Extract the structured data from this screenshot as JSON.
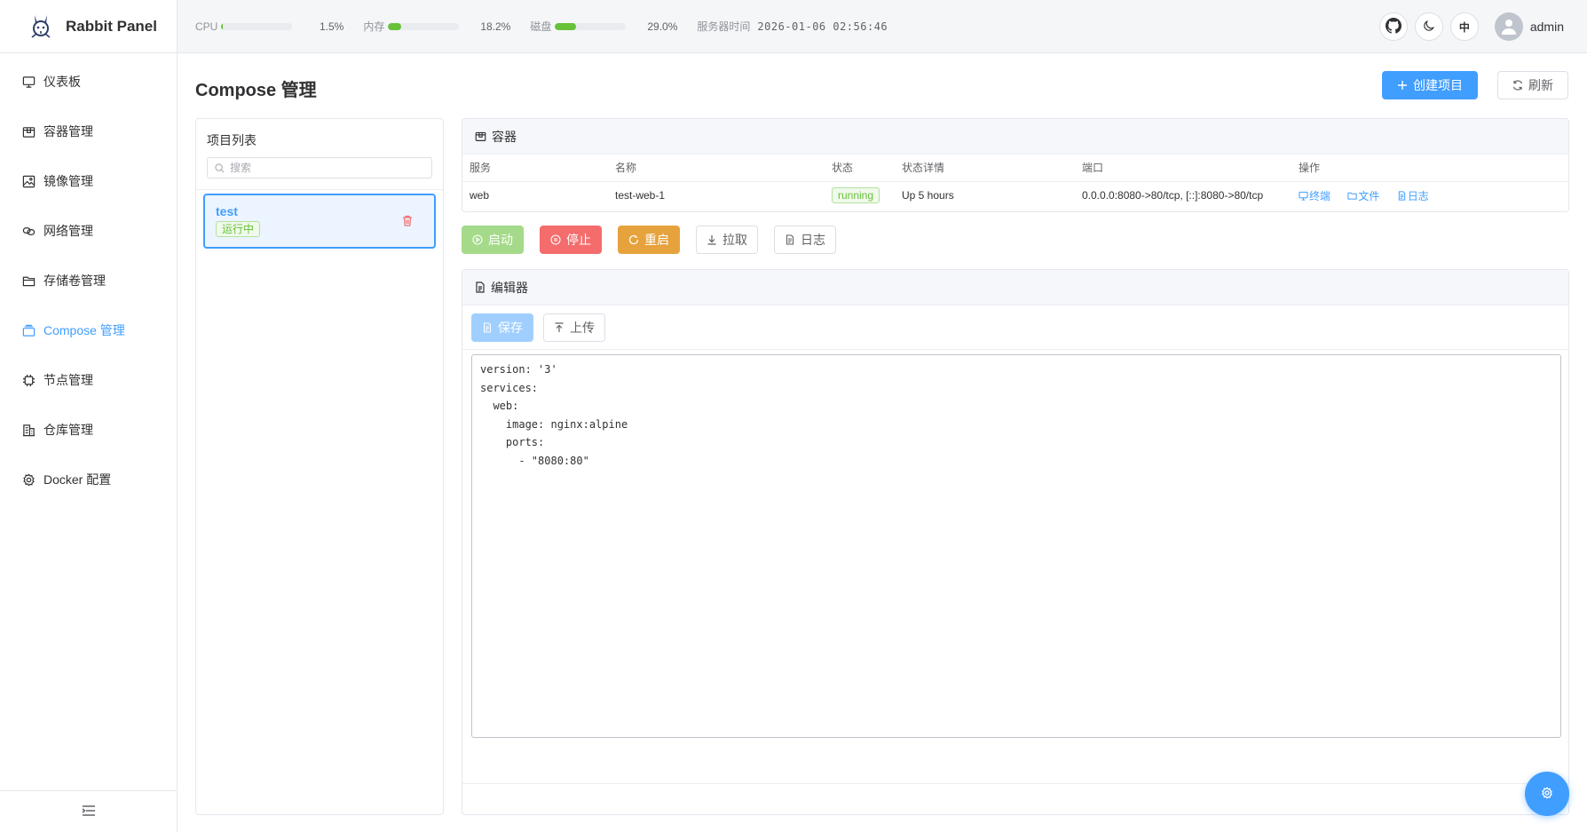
{
  "app": {
    "name": "Rabbit Panel"
  },
  "header": {
    "stats": [
      {
        "label": "CPU",
        "value": "1.5%",
        "percent": 1.5
      },
      {
        "label": "内存",
        "value": "18.2%",
        "percent": 18.2
      },
      {
        "label": "磁盘",
        "value": "29.0%",
        "percent": 29.0
      }
    ],
    "server_time_label": "服务器时间",
    "server_time": "2026-01-06 02:56:46",
    "lang_label": "中",
    "username": "admin"
  },
  "sidebar": {
    "items": [
      {
        "label": "仪表板",
        "icon": "monitor-icon"
      },
      {
        "label": "容器管理",
        "icon": "box-icon"
      },
      {
        "label": "镜像管理",
        "icon": "picture-icon"
      },
      {
        "label": "网络管理",
        "icon": "link-icon"
      },
      {
        "label": "存储卷管理",
        "icon": "folder-icon"
      },
      {
        "label": "Compose 管理",
        "icon": "stack-icon",
        "active": true
      },
      {
        "label": "节点管理",
        "icon": "cpu-icon"
      },
      {
        "label": "仓库管理",
        "icon": "building-icon"
      },
      {
        "label": "Docker 配置",
        "icon": "gear-icon"
      }
    ]
  },
  "page": {
    "title": "Compose 管理",
    "create_label": "创建项目",
    "refresh_label": "刷新"
  },
  "projects": {
    "title": "项目列表",
    "search_placeholder": "搜索",
    "items": [
      {
        "name": "test",
        "status": "运行中"
      }
    ]
  },
  "containers": {
    "title": "容器",
    "columns": [
      "服务",
      "名称",
      "状态",
      "状态详情",
      "端口",
      "操作"
    ],
    "rows": [
      {
        "service": "web",
        "name": "test-web-1",
        "state": "running",
        "detail": "Up 5 hours",
        "ports": "0.0.0.0:8080->80/tcp, [::]:8080->80/tcp"
      }
    ],
    "ops": [
      "终端",
      "文件",
      "日志"
    ]
  },
  "actions": {
    "start": "启动",
    "stop": "停止",
    "restart": "重启",
    "pull": "拉取",
    "logs": "日志"
  },
  "editor": {
    "title": "编辑器",
    "save_label": "保存",
    "upload_label": "上传",
    "content": "version: '3'\nservices:\n  web:\n    image: nginx:alpine\n    ports:\n      - \"8080:80\""
  },
  "colors": {
    "primary": "#409eff",
    "success": "#67c23a",
    "danger": "#f56c6c",
    "warning": "#e6a23c"
  }
}
